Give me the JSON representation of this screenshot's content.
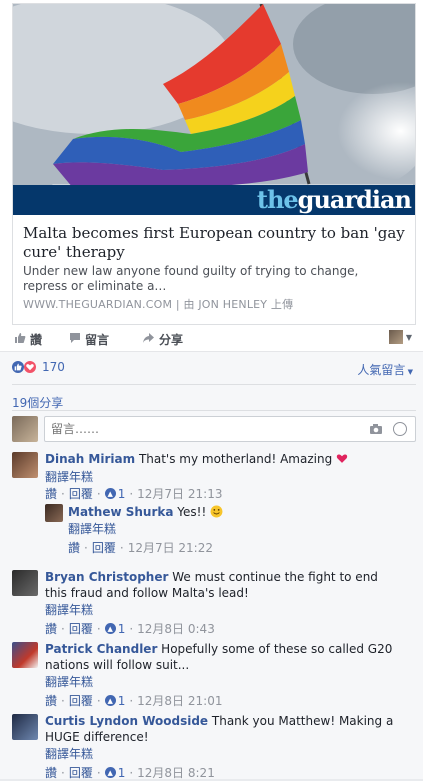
{
  "card": {
    "logo_the": "the",
    "logo_guardian": "guardian",
    "title": "Malta becomes first European country to ban 'gay cure' therapy",
    "description": "Under new law anyone found guilty of trying to change, repress or eliminate a…",
    "source": "WWW.THEGUARDIAN.COM | 由 JON HENLEY 上傳"
  },
  "actions": {
    "like": "讚",
    "comment": "留言",
    "share": "分享"
  },
  "reactions": {
    "count": "170",
    "sort_label": "人氣留言"
  },
  "shares_label": "19個分享",
  "comment_input": {
    "placeholder": "留言……"
  },
  "comments": [
    {
      "name": "Dinah Miriam",
      "text": " That's my motherland! Amazing ",
      "translate": "翻譯年糕",
      "like": "讚",
      "reply": "回覆",
      "likes": "1",
      "time": "12月7日 21:13",
      "reply_comment": {
        "name": "Mathew Shurka",
        "text": " Yes!! ",
        "translate": "翻譯年糕",
        "like": "讚",
        "reply": "回覆",
        "time": "12月7日 21:22"
      }
    },
    {
      "name": "Bryan Christopher",
      "text": " We must continue the fight to end this fraud and follow Malta's lead!",
      "translate": "翻譯年糕",
      "like": "讚",
      "reply": "回覆",
      "likes": "1",
      "time": "12月8日 0:43"
    },
    {
      "name": "Patrick Chandler",
      "text": " Hopefully some of these so called G20 nations will follow suit...",
      "translate": "翻譯年糕",
      "like": "讚",
      "reply": "回覆",
      "likes": "1",
      "time": "12月8日 21:01"
    },
    {
      "name": "Curtis Lyndon Woodside",
      "text": " Thank you Matthew! Making a HUGE difference!",
      "translate": "翻譯年糕",
      "like": "讚",
      "reply": "回覆",
      "likes": "1",
      "time": "12月8日 8:21"
    }
  ],
  "colors": {
    "link": "#365899",
    "guardian_bar": "#05376b",
    "like_blue": "#4267b2",
    "love_red": "#f25268"
  }
}
